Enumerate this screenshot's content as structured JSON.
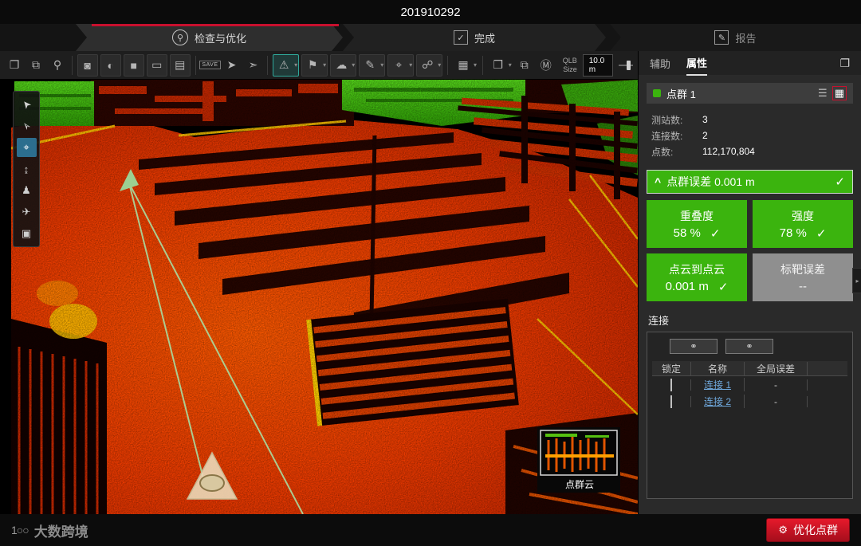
{
  "title_bar": {
    "title": "201910292"
  },
  "workflow": {
    "tabs": [
      {
        "label": "检查与优化",
        "icon": "⚲"
      },
      {
        "label": "完成",
        "icon": "✓"
      },
      {
        "label": "报告",
        "icon": "✎"
      }
    ]
  },
  "toolbar": {
    "icons": {
      "import": "❐",
      "duplicate": "⧉",
      "zoom": "⚲",
      "camera": "◙",
      "contrast": "◐",
      "blackout": "■",
      "panorama": "▭",
      "filmstrip": "▤",
      "save": "SAVE",
      "cursor": "➤",
      "pick": "➣",
      "warning": "⚠",
      "tag": "⚑",
      "cloud": "☁",
      "pen": "✎",
      "pin": "⌖",
      "link": "☍",
      "grid": "▦",
      "cube": "❒",
      "screens": "⧉",
      "station_m": "Ⓜ"
    },
    "qlb": {
      "line1": "QLB",
      "line2": "Size",
      "value": "10.0 m"
    }
  },
  "left_tools": {
    "select": "➤",
    "select_plus": "➣",
    "pan": "⌖",
    "measure": "↨",
    "walk": "♟",
    "fly": "✈",
    "slice": "▣"
  },
  "right_panel": {
    "tabs": {
      "assist": "辅助",
      "properties": "属性"
    },
    "bundle": {
      "title": "点群 1",
      "stats": [
        {
          "label": "测站数:",
          "value": "3"
        },
        {
          "label": "连接数:",
          "value": "2"
        },
        {
          "label": "点数:",
          "value": "112,170,804"
        }
      ],
      "banner": {
        "collapse": "^",
        "label": "点群误差",
        "value": "0.001 m",
        "check": "✓"
      },
      "tiles": [
        {
          "label": "重叠度",
          "value": "58 %",
          "check": "✓"
        },
        {
          "label": "强度",
          "value": "78 %",
          "check": "✓"
        },
        {
          "label": "点云到点云",
          "value": "0.001 m",
          "check": "✓"
        },
        {
          "label": "标靶误差",
          "value": "--",
          "check": ""
        }
      ]
    },
    "links": {
      "title": "连接",
      "button_icon": "⚭",
      "headers": [
        "锁定",
        "名称",
        "全局误差"
      ],
      "rows": [
        {
          "name": "连接 1",
          "error": "-"
        },
        {
          "name": "连接 2",
          "error": "-"
        }
      ]
    }
  },
  "viewport": {
    "thumbnail_label": "点群云"
  },
  "bottom_bar": {
    "watermark": "大数跨境",
    "logo": "1○○",
    "optimize_label": "优化点群",
    "optimize_icon": "⚙"
  },
  "icons": {
    "caret_down": "▾",
    "list_view": "☰",
    "grid_view": "▦",
    "dual_pane": "❐",
    "collapse_right": "▸"
  },
  "colors": {
    "accent_red": "#c8102e",
    "status_green": "#3bb40e",
    "link_blue": "#6fa8dc"
  }
}
